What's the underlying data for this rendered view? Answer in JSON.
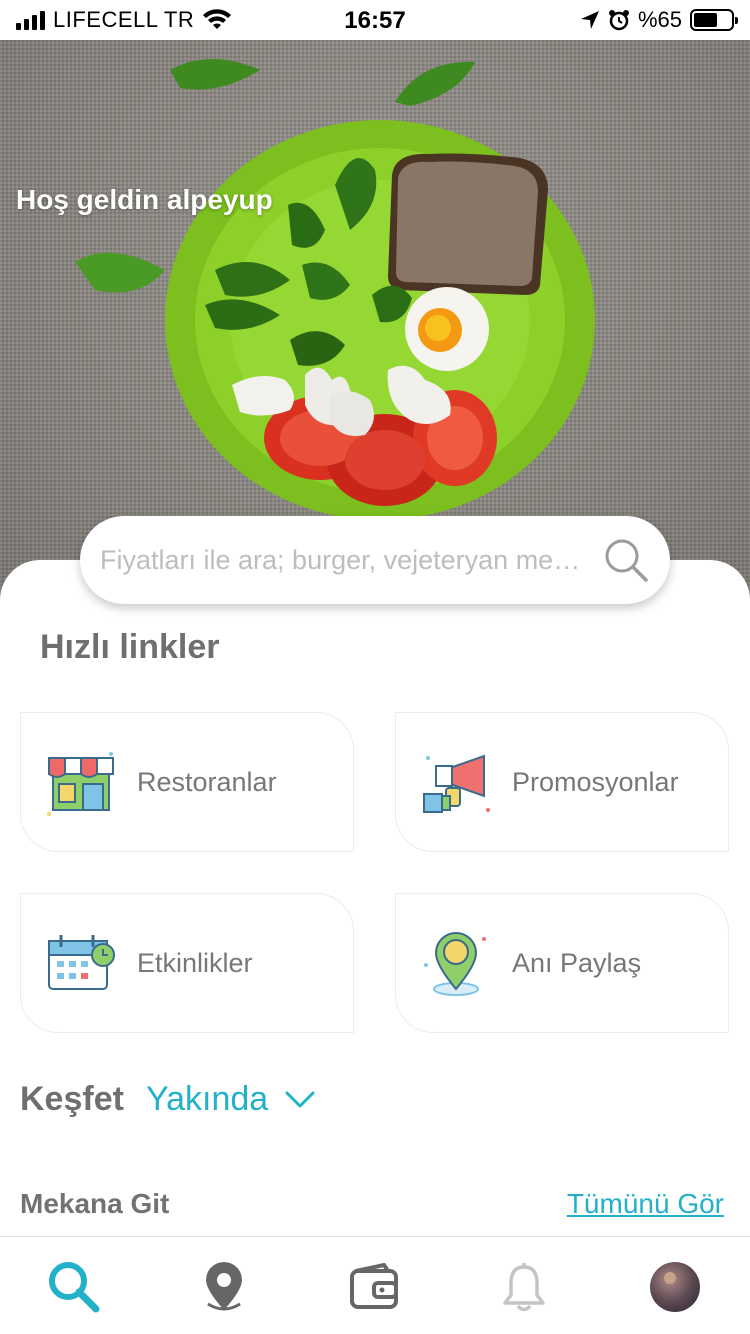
{
  "status_bar": {
    "carrier": "LIFECELL TR",
    "time": "16:57",
    "battery": "%65",
    "battery_level": 0.65
  },
  "hero": {
    "welcome": "Hoş geldin alpeyup"
  },
  "search": {
    "placeholder": "Fiyatları ile ara; burger, vejeteryan me…"
  },
  "quick_links": {
    "title": "Hızlı linkler",
    "items": [
      {
        "label": "Restoranlar",
        "icon": "store-icon"
      },
      {
        "label": "Promosyonlar",
        "icon": "megaphone-icon"
      },
      {
        "label": "Etkinlikler",
        "icon": "calendar-icon"
      },
      {
        "label": "Anı Paylaş",
        "icon": "location-pin-icon"
      }
    ]
  },
  "discover": {
    "label": "Keşfet",
    "selected": "Yakında"
  },
  "venues": {
    "title": "Mekana Git",
    "see_all": "Tümünü Gör"
  },
  "tabbar": {
    "items": [
      "search-icon",
      "map-pin-icon",
      "wallet-icon",
      "bell-icon",
      "avatar"
    ],
    "active_index": 0
  },
  "colors": {
    "accent": "#23b1c9",
    "heading": "#6f6f6f",
    "muted": "#bdbdbd"
  }
}
